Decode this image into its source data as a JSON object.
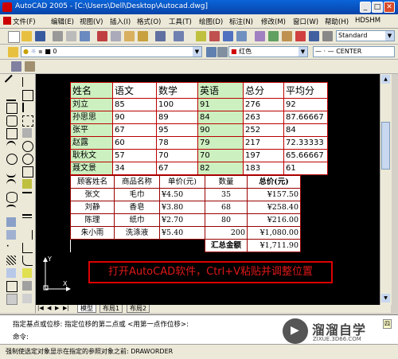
{
  "window": {
    "title": "AutoCAD 2005 - [C:\\Users\\Dell\\Desktop\\Autocad.dwg]"
  },
  "menu": [
    "文件(F)",
    "编辑(E)",
    "视图(V)",
    "插入(I)",
    "格式(O)",
    "工具(T)",
    "绘图(D)",
    "标注(N)",
    "修改(M)",
    "窗口(W)",
    "帮助(H)",
    "HDSHM"
  ],
  "toolbar": {
    "style_value": "Standard",
    "layer_value": "0",
    "color_value": "红色",
    "linetype_value": "CENTER"
  },
  "table1": {
    "headers": [
      "姓名",
      "语文",
      "数学",
      "英语",
      "总分",
      "平均分"
    ],
    "rows": [
      [
        "刘立",
        "85",
        "100",
        "91",
        "276",
        "92"
      ],
      [
        "孙思思",
        "90",
        "89",
        "84",
        "263",
        "87.66667"
      ],
      [
        "张平",
        "67",
        "95",
        "90",
        "252",
        "84"
      ],
      [
        "赵露",
        "60",
        "78",
        "79",
        "217",
        "72.33333"
      ],
      [
        "耿秋文",
        "57",
        "70",
        "70",
        "197",
        "65.66667"
      ],
      [
        "聂文景",
        "34",
        "67",
        "82",
        "183",
        "61"
      ]
    ]
  },
  "table2": {
    "headers": [
      "顾客姓名",
      "商品名称",
      "单价(元)",
      "数量",
      "总价(元)"
    ],
    "rows": [
      [
        "张文",
        "毛巾",
        "¥4.50",
        "35",
        "¥157.50"
      ],
      [
        "刘静",
        "香皂",
        "¥3.80",
        "68",
        "¥258.40"
      ],
      [
        "陈理",
        "纸巾",
        "¥2.70",
        "80",
        "¥216.00"
      ],
      [
        "朱小雨",
        "洗涤液",
        "¥5.40",
        "200",
        "¥1,080.00"
      ]
    ],
    "total_label": "汇总金额",
    "total_value": "¥1,711.90"
  },
  "annotation": "打开AutoCAD软件，Ctrl+V粘贴并调整位置",
  "ucs": {
    "x": "X",
    "y": "Y"
  },
  "tabs": [
    "模型",
    "布局1",
    "布局2"
  ],
  "command": {
    "line1": "指定基点或位移: 指定位移的第二点或 <用第一点作位移>:",
    "line2": "命令:"
  },
  "status": "强制使选定对象显示在指定的参照对象之前: DRAWORDER",
  "watermark": {
    "brand": "溜溜自学",
    "url": "ZIXUE.3D66.COM",
    "tag": "四"
  }
}
